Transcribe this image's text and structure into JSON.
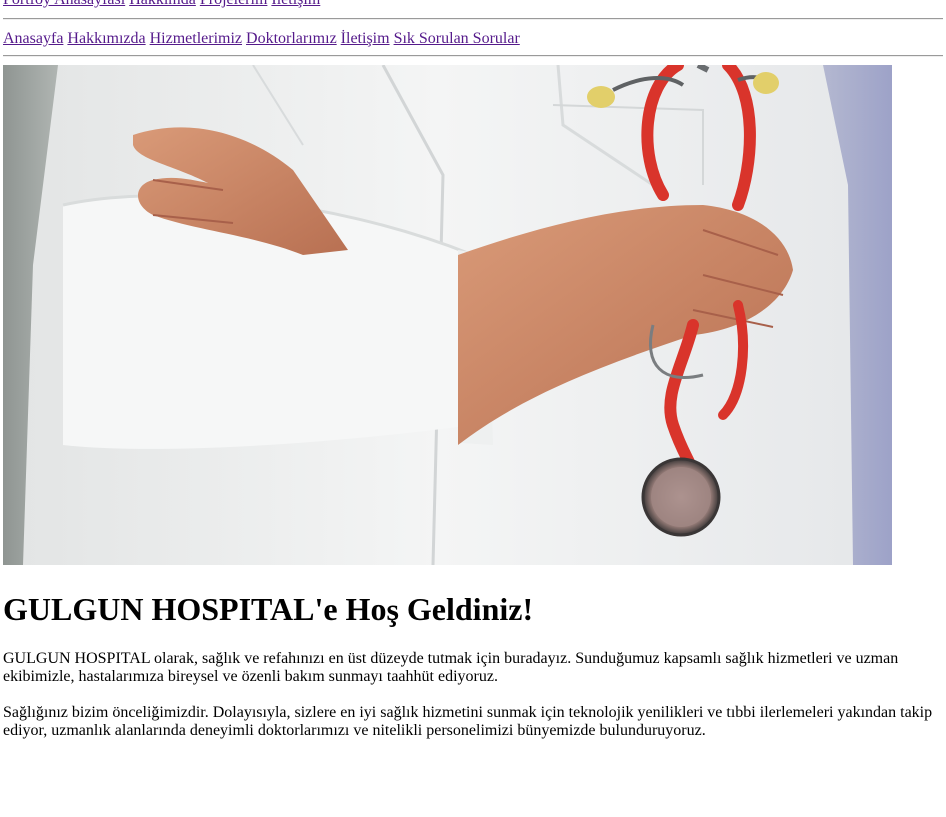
{
  "top_nav": {
    "items": [
      "Portföy Anasayfası",
      "Hakkımda",
      "Projelerim",
      "İletişim"
    ]
  },
  "main_nav": {
    "items": [
      "Anasayfa",
      "Hakkımızda",
      "Hizmetlerimiz",
      "Doktorlarımız",
      "İletişim",
      "Sık Sorulan Sorular"
    ]
  },
  "hero": {
    "icon": "doctor-with-stethoscope-photo"
  },
  "content": {
    "heading": "GULGUN HOSPITAL'e Hoş Geldiniz!",
    "paragraphs": [
      "GULGUN HOSPITAL olarak, sağlık ve refahınızı en üst düzeyde tutmak için buradayız. Sunduğumuz kapsamlı sağlık hizmetleri ve uzman ekibimizle, hastalarımıza bireysel ve özenli bakım sunmayı taahhüt ediyoruz.",
      "Sağlığınız bizim önceliğimizdir. Dolayısıyla, sizlere en iyi sağlık hizmetini sunmak için teknolojik yenilikleri ve tıbbi ilerlemeleri yakından takip ediyor, uzmanlık alanlarında deneyimli doktorlarımızı ve nitelikli personelimizi bünyemizde bulunduruyoruz."
    ]
  },
  "colors": {
    "link": "#551a8b",
    "stethoscope": "#d9342b",
    "coat": "#f2f3f3",
    "skin": "#c8825e"
  }
}
